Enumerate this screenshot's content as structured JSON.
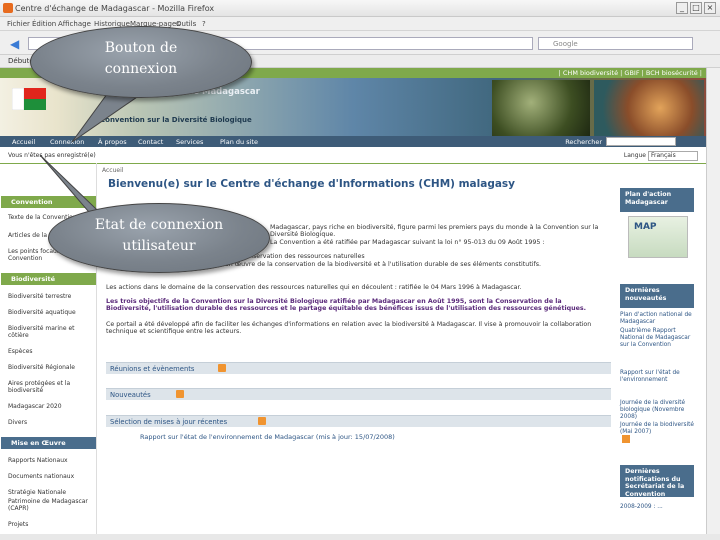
{
  "window": {
    "title": "Centre d'échange de Madagascar - Mozilla Firefox"
  },
  "menu": [
    "Fichier",
    "Édition",
    "Affichage",
    "Historique",
    "Marque-pages",
    "Outils",
    "?"
  ],
  "browser": {
    "search_placeholder": "Google",
    "bookmark_label": "Débuter avec Firefox"
  },
  "top_links": "| CHM biodiversité | GBIF | BCH biosécurité |",
  "banner": {
    "title": "Centre d'échange de Madagascar",
    "subtitle": "Convention sur la Diversité Biologique"
  },
  "main_nav": [
    "Accueil",
    "Connexion",
    "À propos",
    "Contact",
    "Services",
    "Plan du site"
  ],
  "search_label": "Rechercher",
  "user_state": "Vous n'êtes pas enregistré(e)",
  "language": {
    "label": "Langue",
    "value": "Français"
  },
  "breadcrumb": "Accueil",
  "sidebar": {
    "sections": [
      {
        "title": "Convention",
        "items": [
          "Texte de la Convention",
          "Articles de la Convention",
          "Les points focaux de la Convention"
        ]
      },
      {
        "title": "Biodiversité",
        "items": [
          "Biodiversité terrestre",
          "Biodiversité aquatique",
          "Biodiversité marine et côtière",
          "Espèces",
          "Biodiversité Régionale",
          "Aires protégées et la biodiversité",
          "Madagascar 2020",
          "Divers"
        ]
      },
      {
        "title": "Mise en Œuvre",
        "items": [
          "Rapports Nationaux",
          "Documents nationaux",
          "Stratégie Nationale",
          "Patrimoine de Madagascar (CAPR)",
          "Projets"
        ]
      }
    ]
  },
  "main": {
    "title": "Bienvenu(e) sur le Centre d'échange d'Informations (CHM) malagasy",
    "paragraphs": [
      "Madagascar, pays riche en biodiversité, figure parmi les premiers pays du monde à la Convention sur la Diversité Biologique.",
      "La Convention a été ratifiée par Madagascar suivant la loi n° 95-013 du 09 Août 1995 :",
      "- les dispositions qui relèvent de la conservation des ressources naturelles",
      "- et des programmes de mise en œuvre de la conservation de la biodiversité et à l'utilisation durable de ses éléments constitutifs.",
      "Les actions dans le domaine de la conservation des ressources naturelles qui en découlent : ratifiée le 04 Mars 1996 à Madagascar.",
      "Les trois objectifs de la Convention sur la Diversité Biologique ratifiée par Madagascar en Août 1995, sont la Conservation de la Biodiversité, l'utilisation durable des ressources et le partage équitable des bénéfices issus de l'utilisation des ressources génétiques.",
      "Ce portail a été développé afin de faciliter les échanges d'informations en relation avec la biodiversité à Madagascar. Il vise à promouvoir la collaboration technique et scientifique entre les acteurs."
    ],
    "sections": [
      "Réunions et évènements",
      "Nouveautés",
      "Sélection de mises à jour récentes"
    ],
    "recent_link": "Rapport sur l'état de l'environnement de Madagascar (mis à jour: 15/07/2008)"
  },
  "right": {
    "plan_box": "Plan d'action Madagascar",
    "map_label": "MAP",
    "news_box": "Dernières nouveautés",
    "news_items": [
      "Plan d'action national de Madagascar",
      "Quatrième Rapport National de Madagascar sur la Convention",
      "Rapport sur l'état de l'environnement",
      "Journée de la diversité biologique (Novembre 2008)",
      "Journée de la biodiversité (Mai 2007)"
    ],
    "notif_box": "Dernières notifications du Secrétariat de la Convention",
    "notif_item": "2008-2009 : ..."
  },
  "callouts": {
    "login": "Bouton de connexion",
    "state": "Etat de connexion utilisateur"
  }
}
